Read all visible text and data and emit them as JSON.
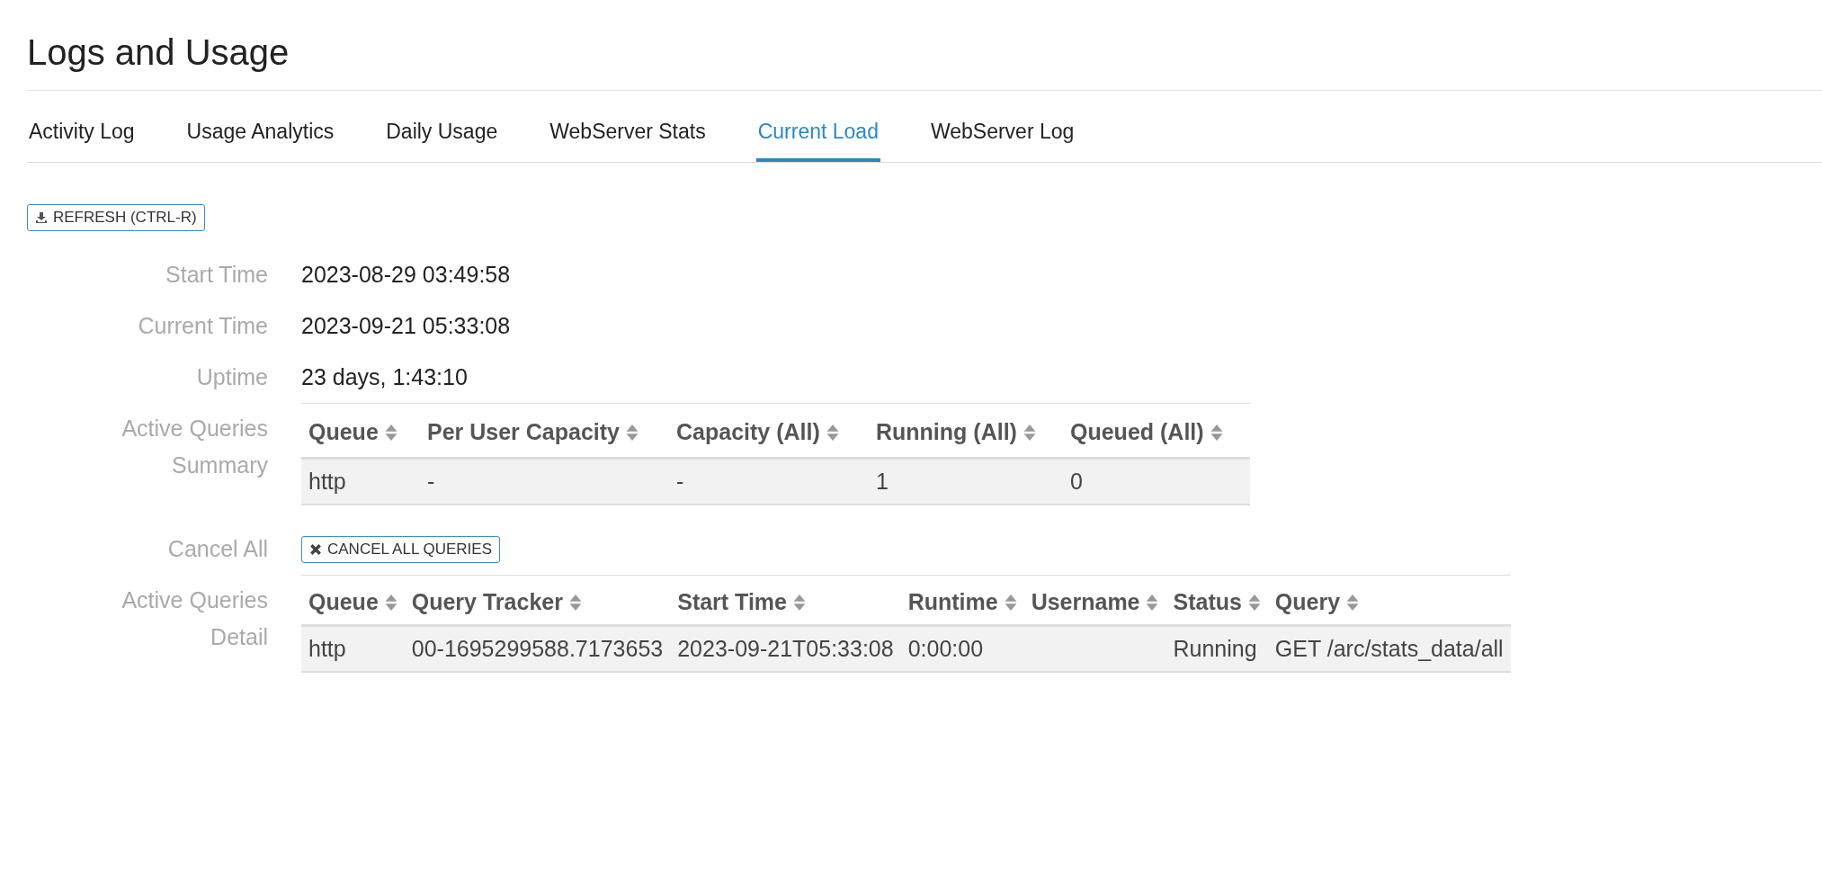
{
  "page_title": "Logs and Usage",
  "tabs": [
    {
      "label": "Activity Log",
      "selected": false
    },
    {
      "label": "Usage Analytics",
      "selected": false
    },
    {
      "label": "Daily Usage",
      "selected": false
    },
    {
      "label": "WebServer Stats",
      "selected": false
    },
    {
      "label": "Current Load",
      "selected": true
    },
    {
      "label": "WebServer Log",
      "selected": false
    }
  ],
  "refresh_button": "REFRESH (CTRL-R)",
  "info": [
    {
      "label": "Start Time",
      "value": "2023-08-29 03:49:58"
    },
    {
      "label": "Current Time",
      "value": "2023-09-21 05:33:08"
    },
    {
      "label": "Uptime",
      "value": "23 days, 1:43:10"
    }
  ],
  "summary": {
    "label": "Active Queries Summary",
    "columns": [
      "Queue",
      "Per User Capacity",
      "Capacity (All)",
      "Running (All)",
      "Queued (All)"
    ],
    "rows": [
      [
        "http",
        "-",
        "-",
        "1",
        "0"
      ]
    ]
  },
  "cancel_all": {
    "label": "Cancel All",
    "button": "CANCEL ALL QUERIES"
  },
  "detail": {
    "label": "Active Queries Detail",
    "columns": [
      "Queue",
      "Query Tracker",
      "Start Time",
      "Runtime",
      "Username",
      "Status",
      "Query"
    ],
    "rows": [
      [
        "http",
        "00-1695299588.7173653",
        "2023-09-21T05:33:08",
        "0:00:00",
        "",
        "Running",
        "GET /arc/stats_data/all"
      ]
    ]
  }
}
